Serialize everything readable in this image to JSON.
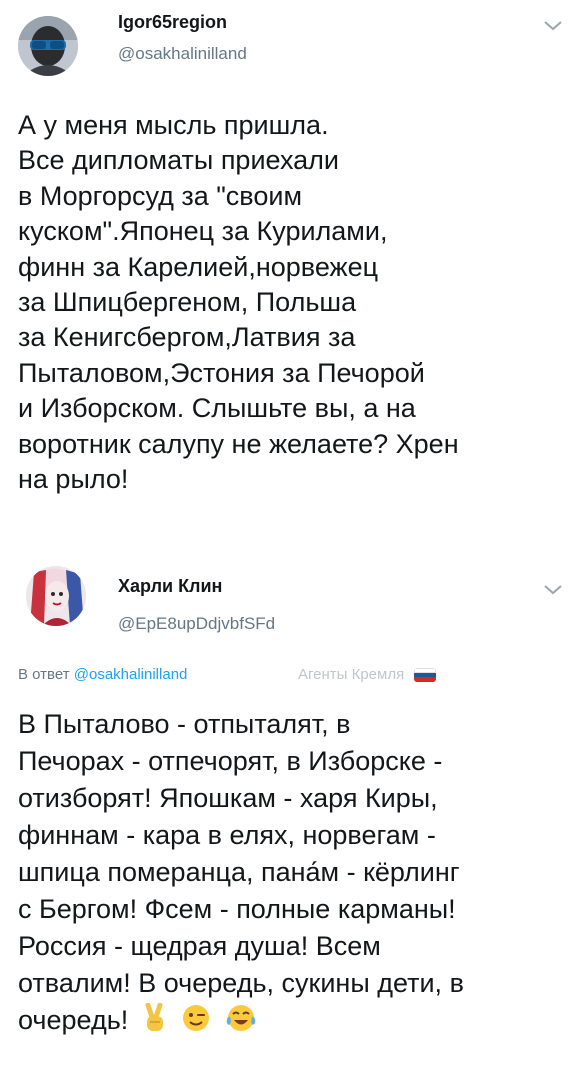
{
  "tweets": [
    {
      "display_name": "Igor65region",
      "handle": "@osakhalinilland",
      "avatar_icon": "avatar-man-sunglasses",
      "lines": [
        "А у меня мысль пришла.",
        "Все дипломаты приехали",
        "в Моргорсуд за \"своим",
        "куском\".Японец за Курилами,",
        "финн за Карелией,норвежец",
        "за Шпицбергеном, Польша",
        "за Кенигсбергом,Латвия за",
        "Пыталовом,Эстония за Печорой",
        "и Изборском. Слышьте вы, а на",
        "воротник салупу не желаете? Хрен",
        "на рыло!"
      ]
    },
    {
      "display_name": "Харли Клин",
      "handle": "@EpE8upDdjvbfSFd",
      "avatar_icon": "avatar-harley-quinn",
      "reply_prefix": "В ответ",
      "reply_to": "@osakhalinilland",
      "badge": "Агенты Кремля",
      "flag_colors": [
        "#ffffff",
        "#1c57a5",
        "#d52b1e"
      ],
      "lines": [
        "В Пыталово - отпыталят,  в",
        "Печорах - отпечорят, в Изборске -",
        "отизборят! Япошкам - харя Киры,",
        "финнам - кара в елях, норвегам -",
        "шпица померанца, пана́м - кёрлинг",
        "с Бергом! Фсем - полные карманы!",
        "Россия - щедрая душа! Всем",
        "отвалим! В очередь, сукины дети, в",
        "очередь!"
      ],
      "emojis": [
        "victory-hand-icon",
        "winking-face-icon",
        "tears-of-joy-icon"
      ]
    }
  ],
  "colors": {
    "text": "#14171a",
    "secondary": "#657786",
    "link": "#1da1f2"
  }
}
